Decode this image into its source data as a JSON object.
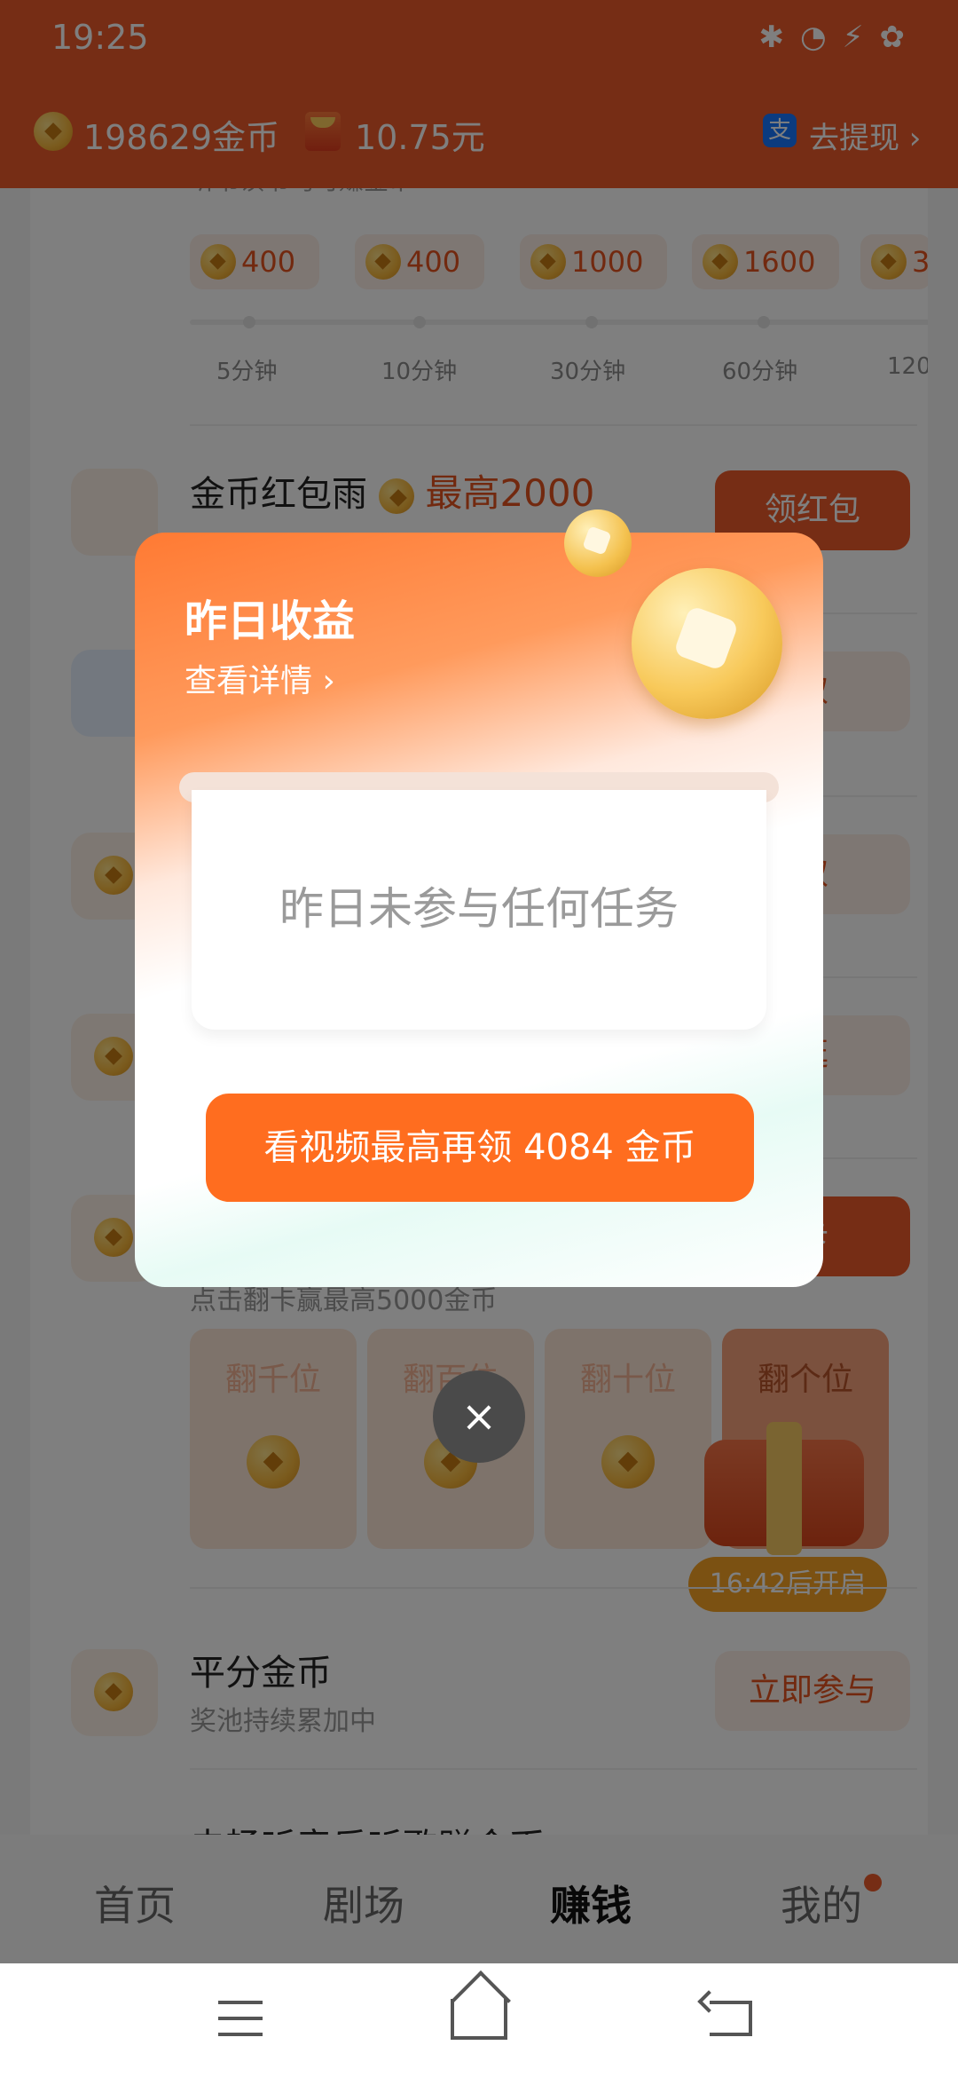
{
  "status_bar": {
    "time": "19:25"
  },
  "header": {
    "coins_text": "198629金币",
    "money_text": "10.75元",
    "alipay_icon_text": "支",
    "withdraw_label": "去提现 ›"
  },
  "listen_task": {
    "desc": "听书读书均可赚金币",
    "rewards": [
      "400",
      "400",
      "1000",
      "1600",
      "3"
    ],
    "times": [
      "5分钟",
      "10分钟",
      "30分钟",
      "60分钟",
      "120"
    ]
  },
  "tasks": {
    "red_rain": {
      "title": "金币红包雨",
      "max": "最高2000",
      "button": "领红包"
    },
    "btn2": "取",
    "btn3": "取",
    "btn4": "逛",
    "btn5": "卡",
    "flip_desc": "点击翻卡赢最高5000金币",
    "flip_cards": [
      "翻千位",
      "翻百位",
      "翻十位",
      "翻个位"
    ],
    "open_timer": "16:42后开启",
    "split": {
      "title": "平分金币",
      "sub": "奖池持续累加中",
      "button": "立即参与"
    },
    "music": {
      "title": "去畅听音乐听歌赚金币"
    }
  },
  "modal": {
    "title": "昨日收益",
    "detail_link": "查看详情 ›",
    "empty_text": "昨日未参与任何任务",
    "cta": "看视频最高再领 4084 金币",
    "close": "×"
  },
  "tabbar": {
    "tabs": [
      "首页",
      "剧场",
      "赚钱",
      "我的"
    ],
    "active_index": 2
  },
  "colors": {
    "brand": "#ec5b2a",
    "cta": "#ff6d1f",
    "coin": "#f6b73c"
  }
}
